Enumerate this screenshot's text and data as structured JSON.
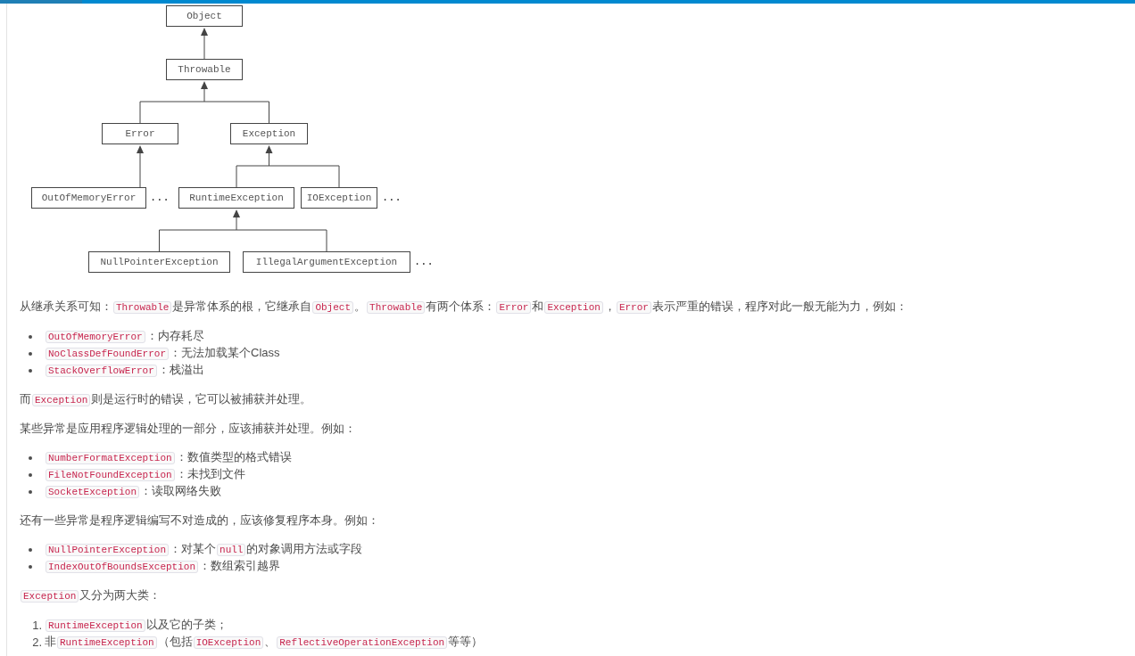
{
  "diagram": {
    "nodes": [
      {
        "kind": "box",
        "label": "Object",
        "children": [
          {
            "kind": "box",
            "label": "Throwable",
            "children": [
              {
                "kind": "box",
                "label": "Error",
                "children": [
                  {
                    "kind": "box",
                    "label": "OutOfMemoryError"
                  },
                  {
                    "kind": "ellipsis",
                    "label": "..."
                  }
                ]
              },
              {
                "kind": "box",
                "label": "Exception",
                "children": [
                  {
                    "kind": "box",
                    "label": "RuntimeException",
                    "children": [
                      {
                        "kind": "box",
                        "label": "NullPointerException"
                      },
                      {
                        "kind": "box",
                        "label": "IllegalArgumentException"
                      },
                      {
                        "kind": "ellipsis",
                        "label": "..."
                      }
                    ]
                  },
                  {
                    "kind": "box",
                    "label": "IOException"
                  },
                  {
                    "kind": "ellipsis",
                    "label": "..."
                  }
                ]
              }
            ]
          }
        ]
      }
    ]
  },
  "content": [
    {
      "kind": "paragraph",
      "segments": [
        {
          "kind": "text",
          "text": "从继承关系可知："
        },
        {
          "kind": "code",
          "text": "Throwable"
        },
        {
          "kind": "text",
          "text": "是异常体系的根，它继承自"
        },
        {
          "kind": "code",
          "text": "Object"
        },
        {
          "kind": "text",
          "text": "。"
        },
        {
          "kind": "code",
          "text": "Throwable"
        },
        {
          "kind": "text",
          "text": "有两个体系："
        },
        {
          "kind": "code",
          "text": "Error"
        },
        {
          "kind": "text",
          "text": "和"
        },
        {
          "kind": "code",
          "text": "Exception"
        },
        {
          "kind": "text",
          "text": "，"
        },
        {
          "kind": "code",
          "text": "Error"
        },
        {
          "kind": "text",
          "text": "表示严重的错误，程序对此一般无能为力，例如："
        }
      ]
    },
    {
      "kind": "bullets",
      "items": [
        {
          "segments": [
            {
              "kind": "code",
              "text": "OutOfMemoryError"
            },
            {
              "kind": "text",
              "text": "：内存耗尽"
            }
          ]
        },
        {
          "segments": [
            {
              "kind": "code",
              "text": "NoClassDefFoundError"
            },
            {
              "kind": "text",
              "text": "：无法加载某个Class"
            }
          ]
        },
        {
          "segments": [
            {
              "kind": "code",
              "text": "StackOverflowError"
            },
            {
              "kind": "text",
              "text": "：栈溢出"
            }
          ]
        }
      ]
    },
    {
      "kind": "paragraph",
      "segments": [
        {
          "kind": "text",
          "text": "而"
        },
        {
          "kind": "code",
          "text": "Exception"
        },
        {
          "kind": "text",
          "text": "则是运行时的错误，它可以被捕获并处理。"
        }
      ]
    },
    {
      "kind": "paragraph",
      "segments": [
        {
          "kind": "text",
          "text": "某些异常是应用程序逻辑处理的一部分，应该捕获并处理。例如："
        }
      ]
    },
    {
      "kind": "bullets",
      "items": [
        {
          "segments": [
            {
              "kind": "code",
              "text": "NumberFormatException"
            },
            {
              "kind": "text",
              "text": "：数值类型的格式错误"
            }
          ]
        },
        {
          "segments": [
            {
              "kind": "code",
              "text": "FileNotFoundException"
            },
            {
              "kind": "text",
              "text": "：未找到文件"
            }
          ]
        },
        {
          "segments": [
            {
              "kind": "code",
              "text": "SocketException"
            },
            {
              "kind": "text",
              "text": "：读取网络失败"
            }
          ]
        }
      ]
    },
    {
      "kind": "paragraph",
      "segments": [
        {
          "kind": "text",
          "text": "还有一些异常是程序逻辑编写不对造成的，应该修复程序本身。例如："
        }
      ]
    },
    {
      "kind": "bullets",
      "items": [
        {
          "segments": [
            {
              "kind": "code",
              "text": "NullPointerException"
            },
            {
              "kind": "text",
              "text": "：对某个"
            },
            {
              "kind": "code",
              "text": "null"
            },
            {
              "kind": "text",
              "text": "的对象调用方法或字段"
            }
          ]
        },
        {
          "segments": [
            {
              "kind": "code",
              "text": "IndexOutOfBoundsException"
            },
            {
              "kind": "text",
              "text": "：数组索引越界"
            }
          ]
        }
      ]
    },
    {
      "kind": "paragraph",
      "segments": [
        {
          "kind": "code",
          "text": "Exception"
        },
        {
          "kind": "text",
          "text": "又分为两大类："
        }
      ]
    },
    {
      "kind": "numbered",
      "items": [
        {
          "number": "1.",
          "segments": [
            {
              "kind": "code",
              "text": "RuntimeException"
            },
            {
              "kind": "text",
              "text": "以及它的子类；"
            }
          ]
        },
        {
          "number": "2.",
          "segments": [
            {
              "kind": "text",
              "text": "非"
            },
            {
              "kind": "code",
              "text": "RuntimeException"
            },
            {
              "kind": "text",
              "text": "（包括"
            },
            {
              "kind": "code",
              "text": "IOException"
            },
            {
              "kind": "text",
              "text": "、"
            },
            {
              "kind": "code",
              "text": "ReflectiveOperationException"
            },
            {
              "kind": "text",
              "text": "等等）"
            }
          ]
        }
      ]
    }
  ]
}
